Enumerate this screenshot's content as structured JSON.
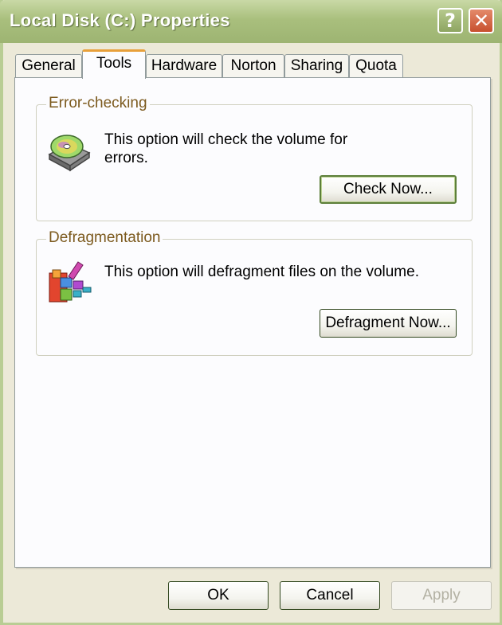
{
  "window": {
    "title": "Local Disk (C:) Properties",
    "help_glyph": "?",
    "close_glyph": "✕"
  },
  "tabs": [
    {
      "label": "General",
      "active": false
    },
    {
      "label": "Tools",
      "active": true
    },
    {
      "label": "Hardware",
      "active": false
    },
    {
      "label": "Norton",
      "active": false
    },
    {
      "label": "Sharing",
      "active": false
    },
    {
      "label": "Quota",
      "active": false
    }
  ],
  "error_checking": {
    "title": "Error-checking",
    "description": "This option will check the volume for errors.",
    "button_label": "Check Now..."
  },
  "defragmentation": {
    "title": "Defragmentation",
    "description": "This option will defragment files on the volume.",
    "button_label": "Defragment Now..."
  },
  "footer": {
    "ok_label": "OK",
    "cancel_label": "Cancel",
    "apply_label": "Apply"
  },
  "colors": {
    "titlebar": "#a9bf7d",
    "group_title": "#7c5a1e",
    "close_button": "#c8502f",
    "active_tab_accent": "#e8a03a"
  },
  "icons": {
    "disk_check": "disk-check-icon",
    "defrag": "defragment-icon"
  }
}
